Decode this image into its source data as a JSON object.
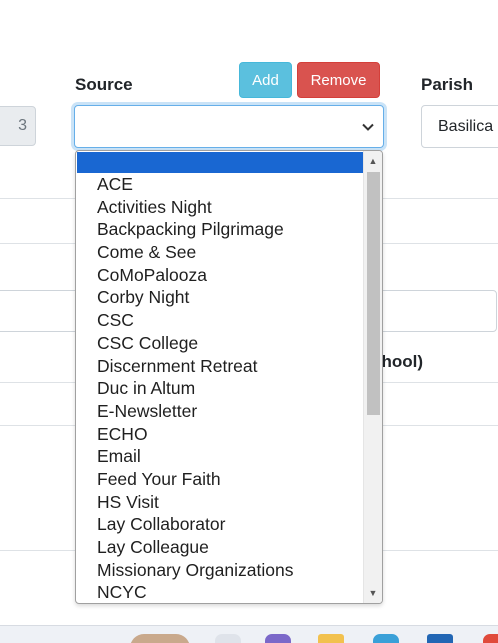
{
  "form": {
    "prev_field_value": "3",
    "source_label": "Source",
    "add_button": "Add",
    "remove_button": "Remove",
    "parish_label": "Parish",
    "parish_value": "Basilica",
    "partial_text": "chool)"
  },
  "source_select": {
    "selected": "",
    "options": [
      "",
      "ACE",
      "Activities Night",
      "Backpacking Pilgrimage",
      "Come & See",
      "CoMoPalooza",
      "Corby Night",
      "CSC",
      "CSC College",
      "Discernment Retreat",
      "Duc in Altum",
      "E-Newsletter",
      "ECHO",
      "Email",
      "Feed Your Faith",
      "HS Visit",
      "Lay Collaborator",
      "Lay Colleague",
      "Missionary Organizations",
      "NCYC"
    ]
  },
  "colors": {
    "add_button": "#5bc0de",
    "remove_button": "#d9534f",
    "selected_option": "#1967d2",
    "focus_border": "#66afe9"
  },
  "icons": {
    "select_arrow": "chevron-down-icon",
    "scroll_up": "scroll-up-arrow-icon",
    "scroll_down": "scroll-down-arrow-icon"
  }
}
